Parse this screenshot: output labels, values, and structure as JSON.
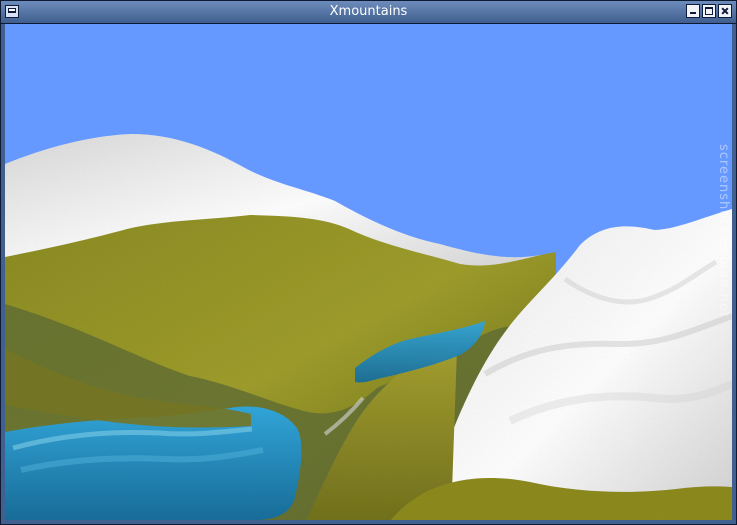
{
  "window": {
    "title": "Xmountains",
    "buttons": {
      "menu": "window-menu",
      "minimize": "minimize",
      "maximize": "maximize",
      "close": "close"
    }
  },
  "scene": {
    "watermark": "screenshots.debian.net",
    "colors": {
      "sky": "#6699ff",
      "snow": "#e8e8e8",
      "grass": "#8a8a1a",
      "water": "#2288bb"
    }
  }
}
